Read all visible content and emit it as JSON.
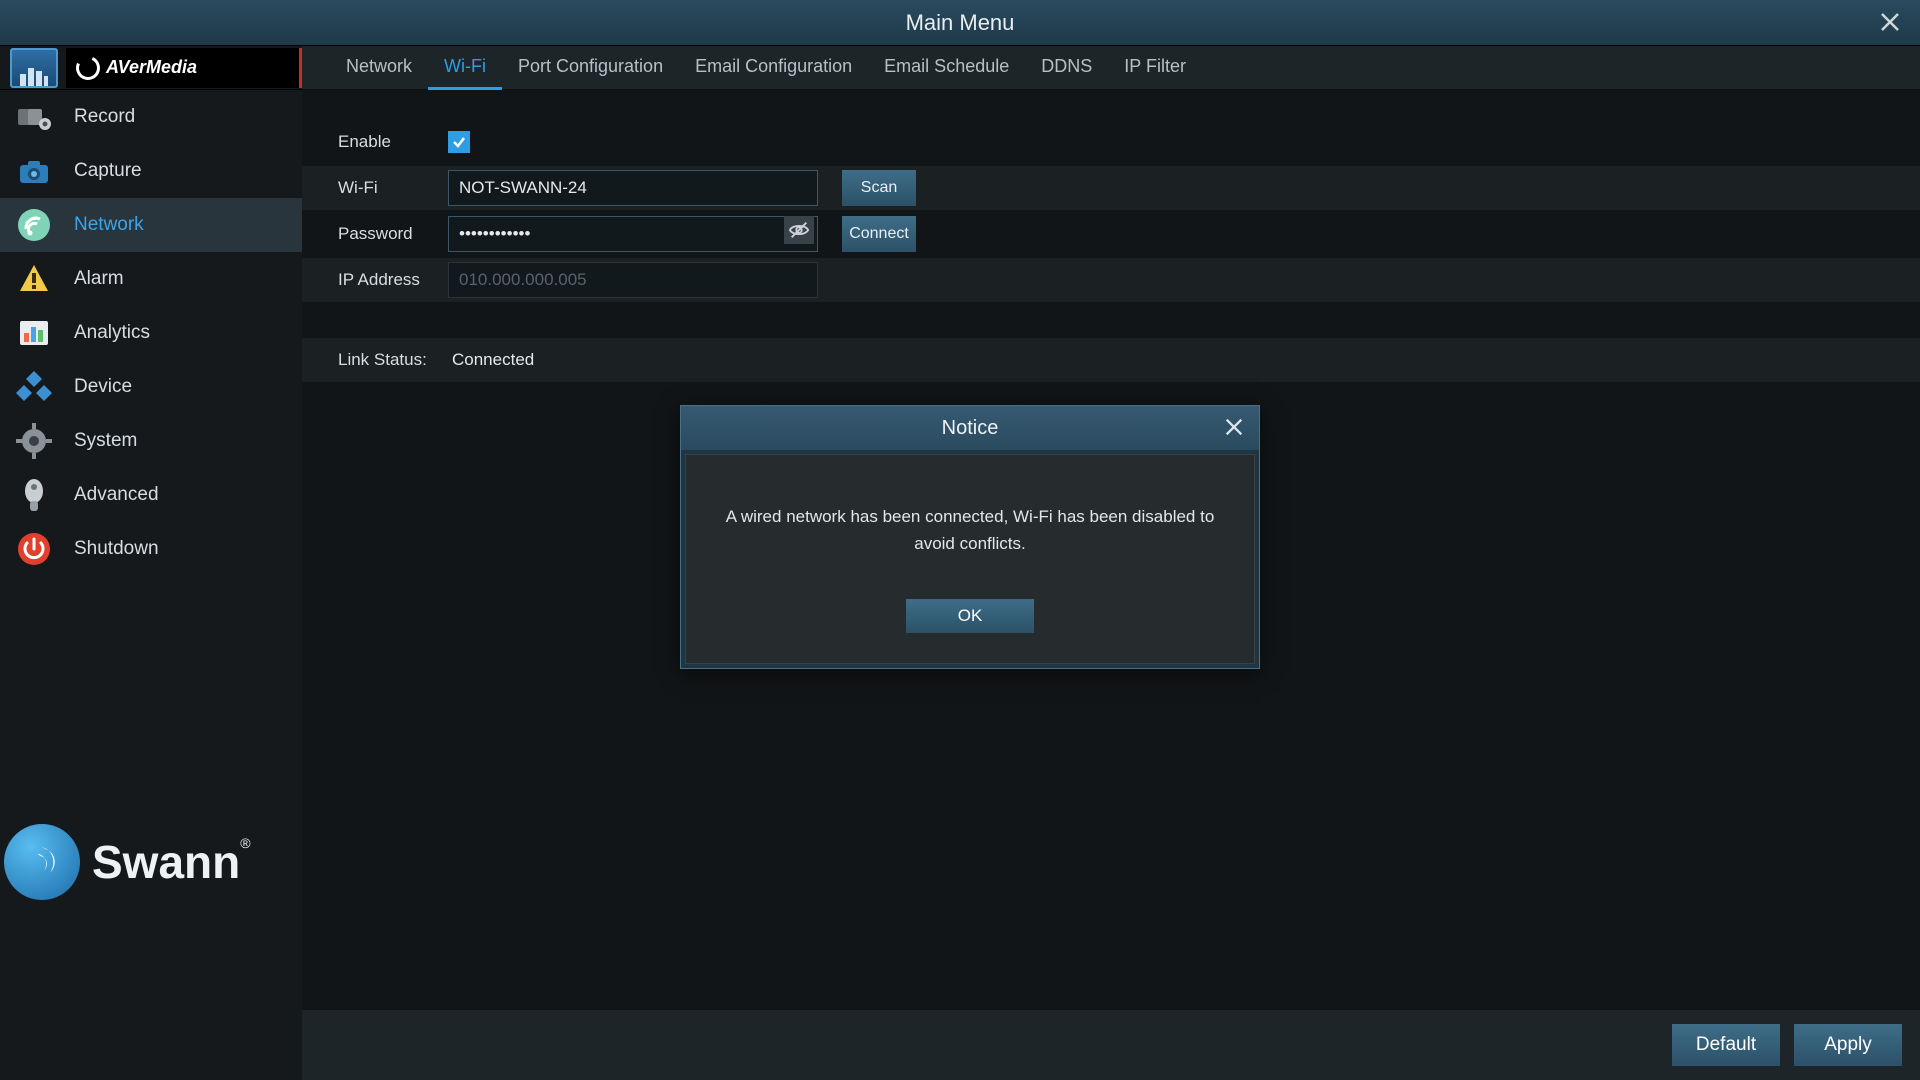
{
  "window": {
    "title": "Main Menu"
  },
  "brand": {
    "top_logo_text": "AVerMedia",
    "bottom_brand": "Swann"
  },
  "sidebar": {
    "active_index": 3,
    "items": [
      {
        "label": "",
        "icon": "display-icon"
      },
      {
        "label": "Record",
        "icon": "record-icon"
      },
      {
        "label": "Capture",
        "icon": "capture-icon"
      },
      {
        "label": "Network",
        "icon": "network-icon"
      },
      {
        "label": "Alarm",
        "icon": "alarm-icon"
      },
      {
        "label": "Analytics",
        "icon": "analytics-icon"
      },
      {
        "label": "Device",
        "icon": "device-icon"
      },
      {
        "label": "System",
        "icon": "system-icon"
      },
      {
        "label": "Advanced",
        "icon": "advanced-icon"
      },
      {
        "label": "Shutdown",
        "icon": "shutdown-icon"
      }
    ]
  },
  "tabs": {
    "active_index": 1,
    "items": [
      {
        "label": "Network"
      },
      {
        "label": "Wi-Fi"
      },
      {
        "label": "Port Configuration"
      },
      {
        "label": "Email Configuration"
      },
      {
        "label": "Email Schedule"
      },
      {
        "label": "DDNS"
      },
      {
        "label": "IP Filter"
      }
    ]
  },
  "form": {
    "enable_label": "Enable",
    "enable_checked": true,
    "wifi_label": "Wi-Fi",
    "wifi_value": "NOT-SWANN-24",
    "scan_label": "Scan",
    "password_label": "Password",
    "password_value": "••••••••••••",
    "connect_label": "Connect",
    "ip_label": "IP Address",
    "ip_value": "010.000.000.005",
    "link_status_label": "Link Status:",
    "link_status_value": "Connected"
  },
  "footer": {
    "default_label": "Default",
    "apply_label": "Apply"
  },
  "modal": {
    "title": "Notice",
    "message": "A wired network has been connected, Wi-Fi has been disabled to avoid conflicts.",
    "ok_label": "OK"
  }
}
